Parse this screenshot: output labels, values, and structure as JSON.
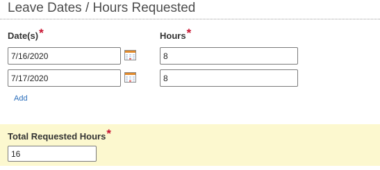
{
  "section": {
    "title": "Leave Dates / Hours Requested"
  },
  "columns": {
    "dates_label": "Date(s)",
    "hours_label": "Hours",
    "required_mark": "*"
  },
  "rows": [
    {
      "date": "7/16/2020",
      "hours": "8"
    },
    {
      "date": "7/17/2020",
      "hours": "8"
    }
  ],
  "add_link": "Add",
  "total": {
    "label": "Total Requested Hours",
    "value": "16"
  },
  "icons": {
    "calendar": "calendar-icon"
  },
  "colors": {
    "required": "#c8102e",
    "link": "#2a6ebb",
    "total_panel_bg": "#fcf8cf"
  }
}
